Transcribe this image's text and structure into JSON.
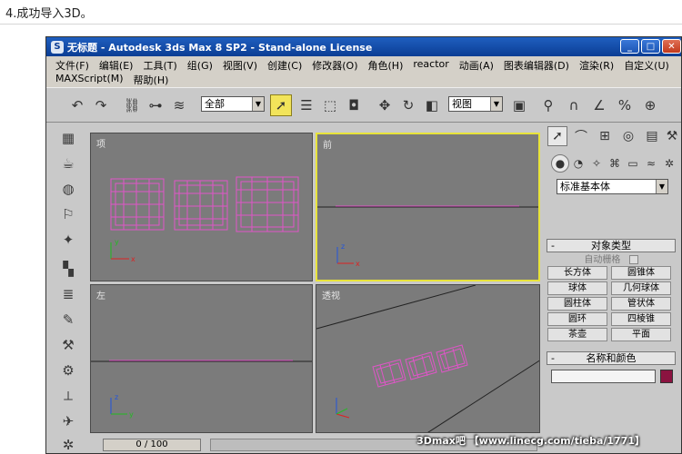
{
  "caption": "4.成功导入3D。",
  "window": {
    "title": "无标题  - Autodesk 3ds Max 8 SP2  - Stand-alone License",
    "app_icon": "3ds-max-icon",
    "minimize_glyph": "_",
    "maximize_glyph": "□",
    "close_glyph": "✕"
  },
  "menu": {
    "row1": [
      "文件(F)",
      "编辑(E)",
      "工具(T)",
      "组(G)",
      "视图(V)",
      "创建(C)",
      "修改器(O)",
      "角色(H)",
      "reactor",
      "动画(A)",
      "图表编辑器(D)",
      "渲染(R)",
      "自定义(U)"
    ],
    "row2": [
      "MAXScript(M)",
      "帮助(H)"
    ]
  },
  "toolbar": {
    "selection_filter": "全部",
    "ref_coord": "视图",
    "icons": [
      "undo-icon",
      "redo-icon",
      "link-icon",
      "unlink-icon",
      "bind-space-warp-icon",
      "select-object-icon",
      "select-by-name-icon",
      "rect-selection-icon",
      "window-crossing-icon",
      "move-icon",
      "rotate-icon",
      "scale-icon",
      "pivot-icon",
      "mirror-icon",
      "snap-icon",
      "angle-snap-icon",
      "percent-snap-icon",
      "spinner-snap-icon"
    ]
  },
  "viewports": {
    "top": "项",
    "front": "前",
    "left": "左",
    "perspective": "透视"
  },
  "axis_labels": {
    "x": "x",
    "y": "y",
    "z": "z"
  },
  "timeline": {
    "value": "0 / 100"
  },
  "command_panel": {
    "dropdown": "标准基本体",
    "object_type_header": "对象类型",
    "autogrid_label": "自动栅格",
    "buttons": [
      "长方体",
      "圆锥体",
      "球体",
      "几何球体",
      "圆柱体",
      "管状体",
      "圆环",
      "四棱锥",
      "茶壶",
      "平面"
    ],
    "name_color_header": "名称和颜色",
    "name_value": "",
    "object_color": "#8b1340"
  },
  "colors": {
    "wireframe": "#e055c8",
    "active_viewport_border": "#e8e33a",
    "titlebar": "#0b3d94"
  },
  "watermark": "3Dmax吧 【www.linecg.com/tieba/1771】"
}
